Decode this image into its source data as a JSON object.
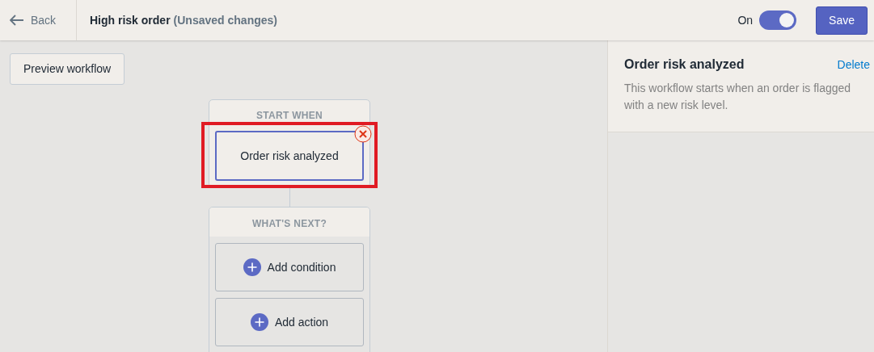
{
  "header": {
    "back": "Back",
    "title": "High risk order",
    "status": "(Unsaved changes)",
    "toggle": {
      "label": "On",
      "on": true
    },
    "save": "Save"
  },
  "toolbar": {
    "preview": "Preview workflow"
  },
  "workflow": {
    "start": {
      "heading": "START WHEN",
      "trigger": {
        "label": "Order risk analyzed",
        "highlighted": true,
        "removable": true
      }
    },
    "next": {
      "heading": "WHAT'S NEXT?",
      "buttons": [
        {
          "label": "Add condition"
        },
        {
          "label": "Add action"
        }
      ]
    }
  },
  "panel": {
    "title": "Order risk analyzed",
    "delete": "Delete",
    "description": "This workflow starts when an order is flagged with a new risk level."
  }
}
